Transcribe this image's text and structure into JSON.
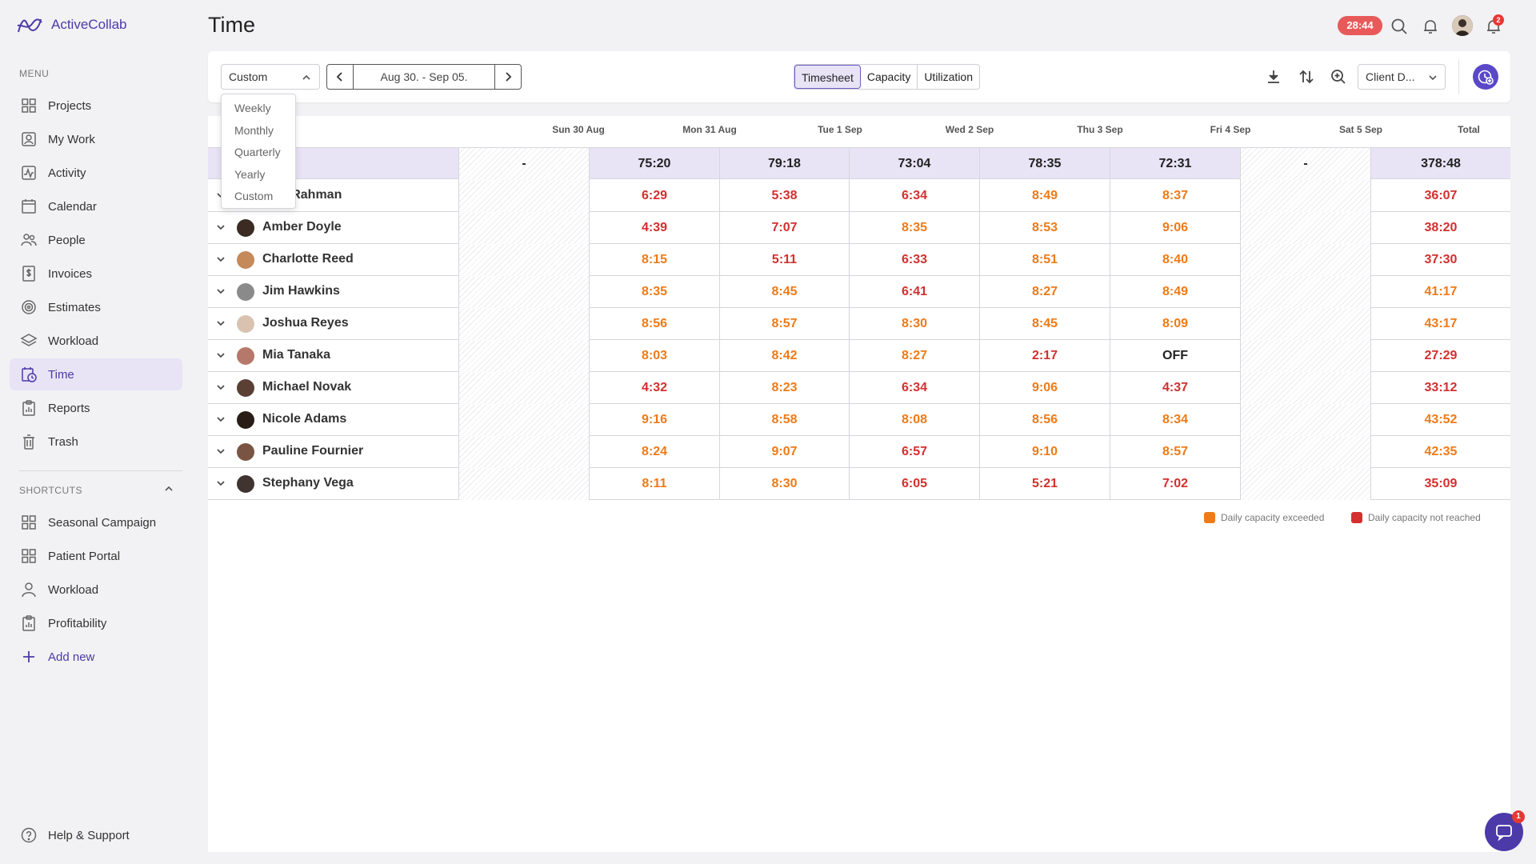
{
  "app": {
    "name": "ActiveCollab",
    "brand_color": "#4b3aa8"
  },
  "sidebar": {
    "menu_label": "MENU",
    "items": [
      {
        "label": "Projects",
        "icon": "grid-icon"
      },
      {
        "label": "My Work",
        "icon": "user-square-icon"
      },
      {
        "label": "Activity",
        "icon": "activity-icon"
      },
      {
        "label": "Calendar",
        "icon": "calendar-icon"
      },
      {
        "label": "People",
        "icon": "people-icon"
      },
      {
        "label": "Invoices",
        "icon": "invoice-icon"
      },
      {
        "label": "Estimates",
        "icon": "target-icon"
      },
      {
        "label": "Workload",
        "icon": "layers-icon"
      },
      {
        "label": "Time",
        "icon": "clock-icon",
        "active": true
      },
      {
        "label": "Reports",
        "icon": "clipboard-icon"
      },
      {
        "label": "Trash",
        "icon": "trash-icon"
      }
    ],
    "shortcuts_label": "SHORTCUTS",
    "shortcuts": [
      {
        "label": "Seasonal Campaign",
        "icon": "grid-icon"
      },
      {
        "label": "Patient Portal",
        "icon": "grid-icon"
      },
      {
        "label": "Workload",
        "icon": "user-icon"
      },
      {
        "label": "Profitability",
        "icon": "clipboard-icon"
      }
    ],
    "add_new": "Add new",
    "help": "Help & Support"
  },
  "header": {
    "title": "Time",
    "timer": "28:44",
    "notification_count": "2"
  },
  "toolbar": {
    "range_select": "Custom",
    "date_range": "Aug 30. - Sep 05.",
    "tabs": [
      "Timesheet",
      "Capacity",
      "Utilization"
    ],
    "active_tab": "Timesheet",
    "client_select": "Client D..."
  },
  "dropdown": {
    "options": [
      "Weekly",
      "Monthly",
      "Quarterly",
      "Yearly",
      "Custom"
    ]
  },
  "table": {
    "columns": [
      "Sun 30 Aug",
      "Mon 31 Aug",
      "Tue 1 Sep",
      "Wed 2 Sep",
      "Thu 3 Sep",
      "Fri 4 Sep",
      "Sat 5 Sep",
      "Total"
    ],
    "totals": [
      "-",
      "75:20",
      "79:18",
      "73:04",
      "78:35",
      "72:31",
      "-",
      "378:48"
    ],
    "rows": [
      {
        "name": "Aisha Rahman",
        "visible_name": "n Rahman",
        "values": [
          "",
          "6:29",
          "5:38",
          "6:34",
          "8:49",
          "8:37",
          "",
          "36:07"
        ],
        "status": [
          "",
          "red",
          "red",
          "red",
          "orange",
          "orange",
          "",
          "red"
        ]
      },
      {
        "name": "Amber Doyle",
        "values": [
          "",
          "4:39",
          "7:07",
          "8:35",
          "8:53",
          "9:06",
          "",
          "38:20"
        ],
        "status": [
          "",
          "red",
          "red",
          "orange",
          "orange",
          "orange",
          "",
          "red"
        ]
      },
      {
        "name": "Charlotte Reed",
        "values": [
          "",
          "8:15",
          "5:11",
          "6:33",
          "8:51",
          "8:40",
          "",
          "37:30"
        ],
        "status": [
          "",
          "orange",
          "red",
          "red",
          "orange",
          "orange",
          "",
          "red"
        ]
      },
      {
        "name": "Jim Hawkins",
        "values": [
          "",
          "8:35",
          "8:45",
          "6:41",
          "8:27",
          "8:49",
          "",
          "41:17"
        ],
        "status": [
          "",
          "orange",
          "orange",
          "red",
          "orange",
          "orange",
          "",
          "orange"
        ]
      },
      {
        "name": "Joshua Reyes",
        "values": [
          "",
          "8:56",
          "8:57",
          "8:30",
          "8:45",
          "8:09",
          "",
          "43:17"
        ],
        "status": [
          "",
          "orange",
          "orange",
          "orange",
          "orange",
          "orange",
          "",
          "orange"
        ]
      },
      {
        "name": "Mia Tanaka",
        "values": [
          "",
          "8:03",
          "8:42",
          "8:27",
          "2:17",
          "OFF",
          "",
          "27:29"
        ],
        "status": [
          "",
          "orange",
          "orange",
          "orange",
          "red",
          "dark",
          "",
          "red"
        ]
      },
      {
        "name": "Michael Novak",
        "values": [
          "",
          "4:32",
          "8:23",
          "6:34",
          "9:06",
          "4:37",
          "",
          "33:12"
        ],
        "status": [
          "",
          "red",
          "orange",
          "red",
          "orange",
          "red",
          "",
          "red"
        ]
      },
      {
        "name": "Nicole Adams",
        "values": [
          "",
          "9:16",
          "8:58",
          "8:08",
          "8:56",
          "8:34",
          "",
          "43:52"
        ],
        "status": [
          "",
          "orange",
          "orange",
          "orange",
          "orange",
          "orange",
          "",
          "orange"
        ]
      },
      {
        "name": "Pauline Fournier",
        "values": [
          "",
          "8:24",
          "9:07",
          "6:57",
          "9:10",
          "8:57",
          "",
          "42:35"
        ],
        "status": [
          "",
          "orange",
          "orange",
          "red",
          "orange",
          "orange",
          "",
          "orange"
        ]
      },
      {
        "name": "Stephany Vega",
        "values": [
          "",
          "8:11",
          "8:30",
          "6:05",
          "5:21",
          "7:02",
          "",
          "35:09"
        ],
        "status": [
          "",
          "orange",
          "orange",
          "red",
          "red",
          "red",
          "",
          "red"
        ]
      }
    ]
  },
  "legend": {
    "exceeded": "Daily capacity exceeded",
    "not_reached": "Daily capacity not reached",
    "exceeded_color": "#f07a16",
    "not_reached_color": "#d32f2f"
  },
  "chat": {
    "unread": "1"
  }
}
